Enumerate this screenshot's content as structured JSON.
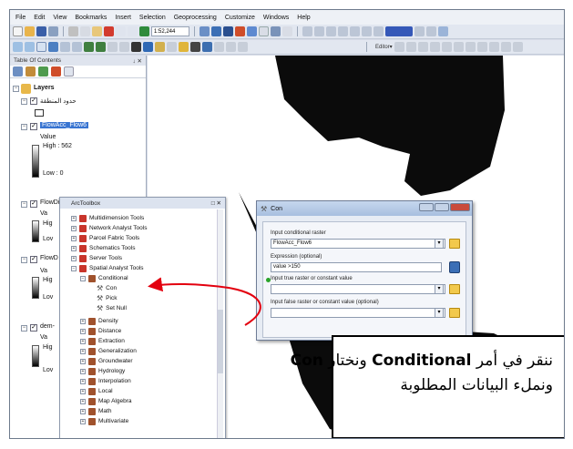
{
  "menu": [
    "File",
    "Edit",
    "View",
    "Bookmarks",
    "Insert",
    "Selection",
    "Geoprocessing",
    "Customize",
    "Windows",
    "Help"
  ],
  "toolbar": {
    "scale": "1:52,244",
    "editor_label": "Editor▾"
  },
  "toc": {
    "title": "Table Of Contents",
    "pin": "↓ ✕",
    "layers_label": "Layers",
    "layer_boundary": "حدود المنطقة",
    "flowacc": {
      "name": "FlowAcc_Flow6",
      "value_label": "Value",
      "high": "High : 562",
      "low": "Low : 0"
    },
    "flowdir": {
      "name": "FlowDir_Extr2",
      "va": "Va",
      "high": "Hig",
      "low": "Lov"
    },
    "flowd": {
      "name": "FlowD",
      "va": "Va",
      "high": "Hig",
      "low": "Lov"
    },
    "dem": {
      "name": "dem-",
      "va": "Va",
      "high": "Hig",
      "low": "Lov"
    }
  },
  "toolbox": {
    "title": "ArcToolbox",
    "close": "□ ✕",
    "items": [
      {
        "label": "Multidimension Tools"
      },
      {
        "label": "Network Analyst Tools"
      },
      {
        "label": "Parcel Fabric Tools"
      },
      {
        "label": "Schematics Tools"
      },
      {
        "label": "Server Tools"
      },
      {
        "label": "Spatial Analyst Tools"
      },
      {
        "label": "Conditional"
      },
      {
        "label": "Con"
      },
      {
        "label": "Pick"
      },
      {
        "label": "Set Null"
      },
      {
        "label": "Density"
      },
      {
        "label": "Distance"
      },
      {
        "label": "Extraction"
      },
      {
        "label": "Generalization"
      },
      {
        "label": "Groundwater"
      },
      {
        "label": "Hydrology"
      },
      {
        "label": "Interpolation"
      },
      {
        "label": "Local"
      },
      {
        "label": "Map Algebra"
      },
      {
        "label": "Math"
      },
      {
        "label": "Multivariate"
      }
    ]
  },
  "con_dialog": {
    "title": "Con",
    "input_label": "Input conditional raster",
    "input_value": "FlowAcc_Flow6",
    "expression_label": "Expression (optional)",
    "expression_value": "value >150",
    "true_label": "Input true raster or constant value",
    "true_value": "",
    "false_label": "Input false raster or constant value (optional)",
    "false_value": ""
  },
  "caption": {
    "line1_a": "ننقر في أمر ",
    "line1_b": "Conditional",
    "line1_c": " ونختار ",
    "line1_d": "Con",
    "line2": "ونملء البيانات المطلوبة"
  },
  "colors": {
    "arrow": "#e3000f",
    "tool_red": "#c9352b",
    "tool_blue": "#3b6fb6"
  }
}
